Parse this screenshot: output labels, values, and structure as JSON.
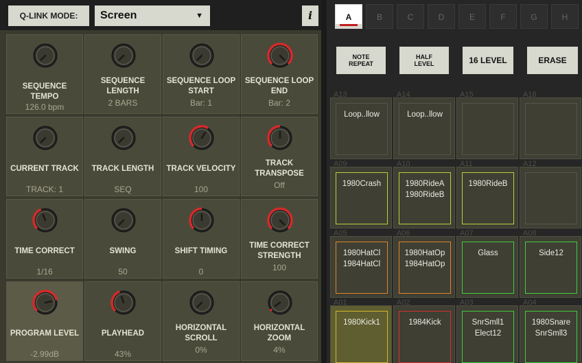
{
  "qlink": {
    "mode_label": "Q-LINK MODE:",
    "mode_value": "Screen",
    "info_label": "i"
  },
  "cells": [
    {
      "label": "SEQUENCE TEMPO",
      "value": "126.0 bpm",
      "level": 0.0
    },
    {
      "label": "SEQUENCE LENGTH",
      "value": "2 BARS",
      "level": 0.0
    },
    {
      "label": "SEQUENCE LOOP START",
      "value": "Bar: 1",
      "level": 0.0
    },
    {
      "label": "SEQUENCE LOOP END",
      "value": "Bar: 2",
      "level": 1.0
    },
    {
      "label": "CURRENT TRACK",
      "value": "TRACK: 1",
      "level": 0.0
    },
    {
      "label": "TRACK LENGTH",
      "value": "SEQ",
      "level": 0.0
    },
    {
      "label": "TRACK VELOCITY",
      "value": "100",
      "level": 0.62
    },
    {
      "label": "TRACK TRANSPOSE",
      "value": "Off",
      "level": 0.5
    },
    {
      "label": "TIME CORRECT",
      "value": "1/16",
      "level": 0.42
    },
    {
      "label": "SWING",
      "value": "50",
      "level": 0.0
    },
    {
      "label": "SHIFT TIMING",
      "value": "0",
      "level": 0.5
    },
    {
      "label": "TIME CORRECT STRENGTH",
      "value": "100",
      "level": 1.0
    },
    {
      "label": "PROGRAM LEVEL",
      "value": "-2.99dB",
      "level": 0.79
    },
    {
      "label": "PLAYHEAD",
      "value": "43%",
      "level": 0.43
    },
    {
      "label": "HORIZONTAL SCROLL",
      "value": "0%",
      "level": 0.0
    },
    {
      "label": "HORIZONTAL ZOOM",
      "value": "4%",
      "level": 0.04
    }
  ],
  "tabs": [
    "A",
    "B",
    "C",
    "D",
    "E",
    "F",
    "G",
    "H"
  ],
  "active_tab": "A",
  "buttons": {
    "note_repeat_1": "NOTE",
    "note_repeat_2": "REPEAT",
    "half_level_1": "HALF",
    "half_level_2": "LEVEL",
    "level16": "16 LEVEL",
    "erase": "ERASE"
  },
  "pads": [
    {
      "num": "A13",
      "line1": "Loop..llow",
      "line2": "",
      "color": "#56564a"
    },
    {
      "num": "A14",
      "line1": "Loop..llow",
      "line2": "",
      "color": "#56564a"
    },
    {
      "num": "A15",
      "line1": "",
      "line2": "",
      "color": "#56564a"
    },
    {
      "num": "A16",
      "line1": "",
      "line2": "",
      "color": "#56564a"
    },
    {
      "num": "A09",
      "line1": "1980Crash",
      "line2": "",
      "color": "#b8d23a"
    },
    {
      "num": "A10",
      "line1": "1980RideA",
      "line2": "1980RideB",
      "color": "#b8d23a"
    },
    {
      "num": "A11",
      "line1": "1980RideB",
      "line2": "",
      "color": "#b8d23a"
    },
    {
      "num": "A12",
      "line1": "",
      "line2": "",
      "color": "#56564a"
    },
    {
      "num": "A05",
      "line1": "1980HatCl",
      "line2": "1984HatCl",
      "color": "#e0862a"
    },
    {
      "num": "A06",
      "line1": "1980HatOp",
      "line2": "1984HatOp",
      "color": "#e0862a"
    },
    {
      "num": "A07",
      "line1": "Glass",
      "line2": "",
      "color": "#3fcf3f"
    },
    {
      "num": "A08",
      "line1": "Side12",
      "line2": "",
      "color": "#3fcf3f"
    },
    {
      "num": "A01",
      "line1": "1980Kick1",
      "line2": "",
      "color": "#d8b830"
    },
    {
      "num": "A02",
      "line1": "1984Kick",
      "line2": "",
      "color": "#d83030"
    },
    {
      "num": "A03",
      "line1": "SnrSmll1",
      "line2": "Elect12",
      "color": "#3fcf3f"
    },
    {
      "num": "A04",
      "line1": "1980Snare",
      "line2": "SnrSmll3",
      "color": "#3fcf3f"
    }
  ],
  "colors": {
    "accent": "#d42a2a",
    "pad_selected_bg": "#5e5e30"
  }
}
